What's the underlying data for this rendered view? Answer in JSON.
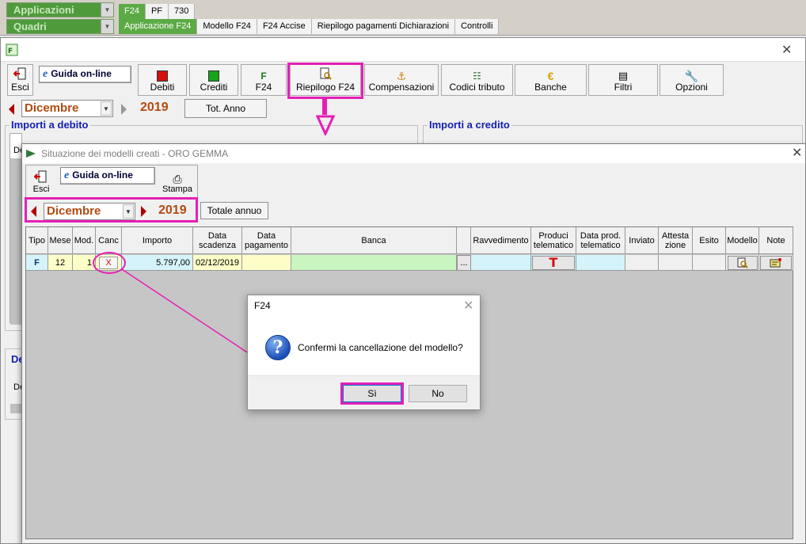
{
  "topbar": {
    "app_select": "Applicazioni",
    "quadri_select": "Quadri",
    "top_tabs": [
      "F24",
      "PF",
      "730"
    ],
    "sub_tabs": [
      "Applicazione F24",
      "Modello F24",
      "F24 Accise",
      "Riepilogo pagamenti Dichiarazioni",
      "Controlli"
    ]
  },
  "mainwin": {
    "toolbar": {
      "esci": "Esci",
      "guida": "Guida on-line",
      "debiti": "Debiti",
      "crediti": "Crediti",
      "f24": "F24",
      "riepilogo": "Riepilogo F24",
      "compensazioni": "Compensazioni",
      "codici": "Codici tributo",
      "banche": "Banche",
      "filtri": "Filtri",
      "opzioni": "Opzioni"
    },
    "month": "Dicembre",
    "year": "2019",
    "tot_anno": "Tot. Anno",
    "section_debito": "Importi a debito",
    "section_credito": "Importi a credito",
    "frag_de1": "De",
    "frag_de2": "De",
    "frag_de3": "De"
  },
  "popup": {
    "title": "Situazione dei modelli creati - ORO GEMMA",
    "esci": "Esci",
    "guida": "Guida on-line",
    "stampa": "Stampa",
    "month": "Dicembre",
    "year": "2019",
    "totale_annuo": "Totale annuo",
    "headers": {
      "tipo": "Tipo",
      "mese": "Mese",
      "mod": "Mod.",
      "canc": "Canc",
      "importo": "Importo",
      "data_scadenza_1": "Data",
      "data_scadenza_2": "scadenza",
      "data_pagamento_1": "Data",
      "data_pagamento_2": "pagamento",
      "banca": "Banca",
      "ravvedimento": "Ravvedimento",
      "produci_1": "Produci",
      "produci_2": "telematico",
      "data_prod_1": "Data prod.",
      "data_prod_2": "telematico",
      "inviato": "Inviato",
      "attestazione_1": "Attesta",
      "attestazione_2": "zione",
      "esito": "Esito",
      "modello": "Modello",
      "note": "Note"
    },
    "row": {
      "tipo": "F",
      "mese": "12",
      "mod": "1",
      "canc": "X",
      "importo": "5.797,00",
      "data_scadenza": "02/12/2019",
      "data_pagamento": "",
      "banca": "",
      "banca_btn": "...",
      "produci": "T"
    }
  },
  "dialog": {
    "title": "F24",
    "message": "Confermi la cancellazione del modello?",
    "yes": "Sì",
    "no": "No"
  },
  "colors": {
    "highlight": "#e51fb6",
    "green_tab": "#5caa45",
    "section_title": "#1420b4",
    "month_text": "#b24a10",
    "row_yellow": "#fdfdc8",
    "row_cyan": "#d5f3fb",
    "row_green": "#c9f5c1"
  }
}
